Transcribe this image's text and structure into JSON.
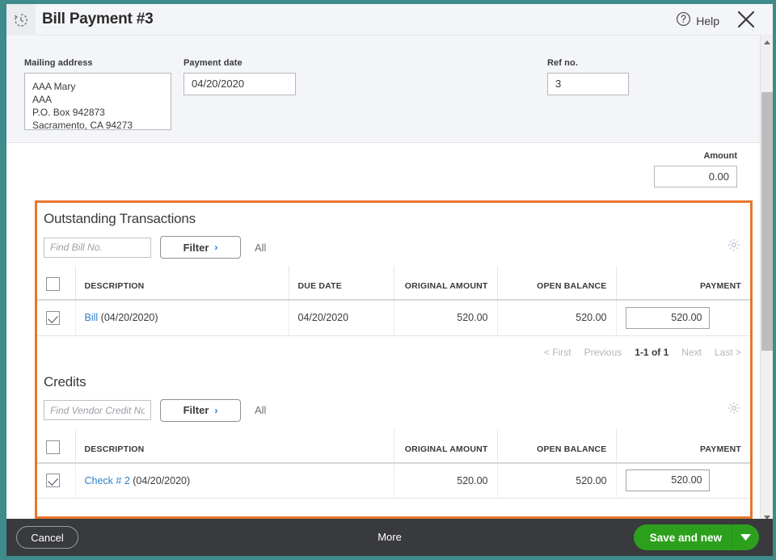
{
  "window": {
    "title": "Bill Payment #3",
    "recurring_icon": "recurring-clock-icon",
    "help_label": "Help",
    "help_icon": "question-circle-icon",
    "close_icon": "close-x-icon"
  },
  "form": {
    "mailing_address_label": "Mailing address",
    "mailing_address_lines": [
      "AAA Mary",
      "AAA",
      "P.O. Box 942873",
      "Sacramento, CA  94273"
    ],
    "payment_date_label": "Payment date",
    "payment_date_value": "04/20/2020",
    "ref_no_label": "Ref no.",
    "ref_no_value": "3",
    "amount_label": "Amount",
    "amount_value": "0.00"
  },
  "outstanding": {
    "title": "Outstanding Transactions",
    "find_placeholder": "Find Bill No.",
    "find_value": "",
    "filter_label": "Filter",
    "filter_chevron": "›",
    "all_label": "All",
    "gear_icon": "gear-icon",
    "columns": [
      "DESCRIPTION",
      "DUE DATE",
      "ORIGINAL AMOUNT",
      "OPEN BALANCE",
      "PAYMENT"
    ],
    "rows": [
      {
        "checked": true,
        "description_link": "Bill",
        "description_rest": "(04/20/2020)",
        "due_date": "04/20/2020",
        "original_amount": "520.00",
        "open_balance": "520.00",
        "payment": "520.00"
      }
    ],
    "pagination": {
      "first": "< First",
      "previous": "Previous",
      "range": "1-1 of 1",
      "next": "Next",
      "last": "Last >"
    }
  },
  "credits": {
    "title": "Credits",
    "find_placeholder": "Find Vendor Credit No.",
    "find_value": "",
    "filter_label": "Filter",
    "filter_chevron": "›",
    "all_label": "All",
    "gear_icon": "gear-icon",
    "columns": [
      "DESCRIPTION",
      "ORIGINAL AMOUNT",
      "OPEN BALANCE",
      "PAYMENT"
    ],
    "rows": [
      {
        "checked": true,
        "description_link": "Check # 2",
        "description_rest": "(04/20/2020)",
        "original_amount": "520.00",
        "open_balance": "520.00",
        "payment": "520.00"
      }
    ]
  },
  "footer": {
    "cancel_label": "Cancel",
    "more_label": "More",
    "save_label": "Save and new",
    "save_caret_icon": "caret-down-icon"
  },
  "colors": {
    "frame_teal": "#3d8b8b",
    "highlight_orange": "#e8762c",
    "save_green": "#2ca01c",
    "link_blue": "#2f80c6",
    "footer_dark": "#393a3d"
  }
}
